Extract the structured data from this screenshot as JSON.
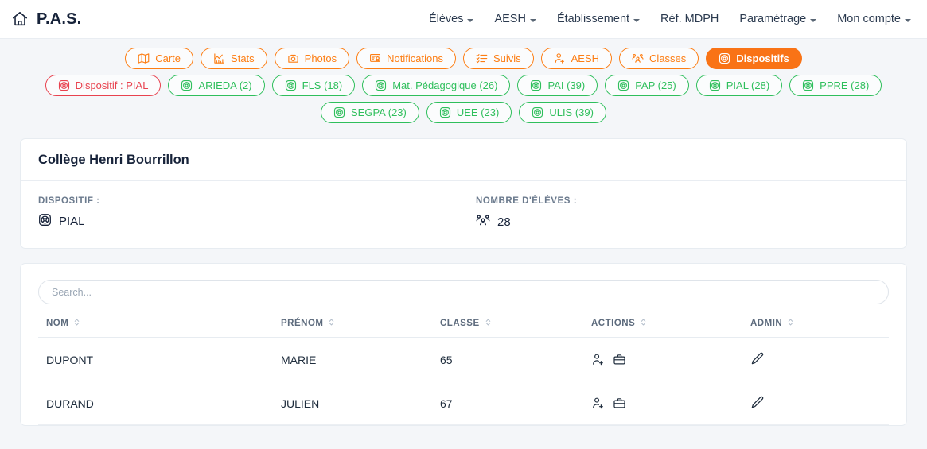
{
  "navbar": {
    "home_icon": "home-icon",
    "brand": "P.A.S.",
    "links": [
      {
        "label": "Élèves",
        "caret": true
      },
      {
        "label": "AESH",
        "caret": true
      },
      {
        "label": "Établissement",
        "caret": true
      },
      {
        "label": "Réf. MDPH",
        "caret": false
      },
      {
        "label": "Paramétrage",
        "caret": true
      },
      {
        "label": "Mon compte",
        "caret": true
      }
    ]
  },
  "tabs": [
    {
      "label": "Carte",
      "icon": "map-icon",
      "state": "orange"
    },
    {
      "label": "Stats",
      "icon": "chart-icon",
      "state": "orange"
    },
    {
      "label": "Photos",
      "icon": "camera-icon",
      "state": "orange"
    },
    {
      "label": "Notifications",
      "icon": "certificate-icon",
      "state": "orange"
    },
    {
      "label": "Suivis",
      "icon": "checklist-icon",
      "state": "orange"
    },
    {
      "label": "AESH",
      "icon": "person-plus-icon",
      "state": "orange"
    },
    {
      "label": "Classes",
      "icon": "people-icon",
      "state": "orange"
    },
    {
      "label": "Dispositifs",
      "icon": "lifebuoy-icon",
      "state": "active"
    }
  ],
  "filters_row1": [
    {
      "label": "Dispositif : PIAL",
      "icon": "lifebuoy-icon",
      "state": "red"
    },
    {
      "label": "ARIEDA (2)",
      "icon": "lifebuoy-icon",
      "state": "green"
    },
    {
      "label": "FLS (18)",
      "icon": "lifebuoy-icon",
      "state": "green"
    },
    {
      "label": "Mat. Pédagogique (26)",
      "icon": "lifebuoy-icon",
      "state": "green"
    },
    {
      "label": "PAI (39)",
      "icon": "lifebuoy-icon",
      "state": "green"
    },
    {
      "label": "PAP (25)",
      "icon": "lifebuoy-icon",
      "state": "green"
    },
    {
      "label": "PIAL (28)",
      "icon": "lifebuoy-icon",
      "state": "green"
    },
    {
      "label": "PPRE (28)",
      "icon": "lifebuoy-icon",
      "state": "green"
    }
  ],
  "filters_row2": [
    {
      "label": "SEGPA (23)",
      "icon": "lifebuoy-icon",
      "state": "green"
    },
    {
      "label": "UEE (23)",
      "icon": "lifebuoy-icon",
      "state": "green"
    },
    {
      "label": "ULIS (39)",
      "icon": "lifebuoy-icon",
      "state": "green"
    }
  ],
  "school_card": {
    "title": "Collège Henri Bourrillon",
    "dispositif_label": "DISPOSITIF :",
    "dispositif_value": "PIAL",
    "dispositif_icon": "lifebuoy-icon",
    "count_label": "NOMBRE D'ÉLÈVES :",
    "count_value": "28",
    "count_icon": "people-icon"
  },
  "table": {
    "search_placeholder": "Search...",
    "search_value": "",
    "columns": [
      {
        "label": "NOM",
        "sortable": true
      },
      {
        "label": "PRÉNOM",
        "sortable": true
      },
      {
        "label": "CLASSE",
        "sortable": true
      },
      {
        "label": "ACTIONS",
        "sortable": true
      },
      {
        "label": "ADMIN",
        "sortable": true
      }
    ],
    "rows": [
      {
        "nom": "DUPONT",
        "prenom": "MARIE",
        "classe": "65",
        "actions": [
          "person-plus-icon",
          "briefcase-icon"
        ],
        "admin": [
          "pencil-icon"
        ]
      },
      {
        "nom": "DURAND",
        "prenom": "JULIEN",
        "classe": "67",
        "actions": [
          "person-plus-icon",
          "briefcase-icon"
        ],
        "admin": [
          "pencil-icon"
        ]
      }
    ]
  },
  "colors": {
    "accent_orange": "#f97316",
    "pill_orange": "#fd7e14",
    "green": "#2fbf5c",
    "red": "#e8424f",
    "page_bg": "#f4f6f9",
    "text_dark": "#17233a"
  }
}
